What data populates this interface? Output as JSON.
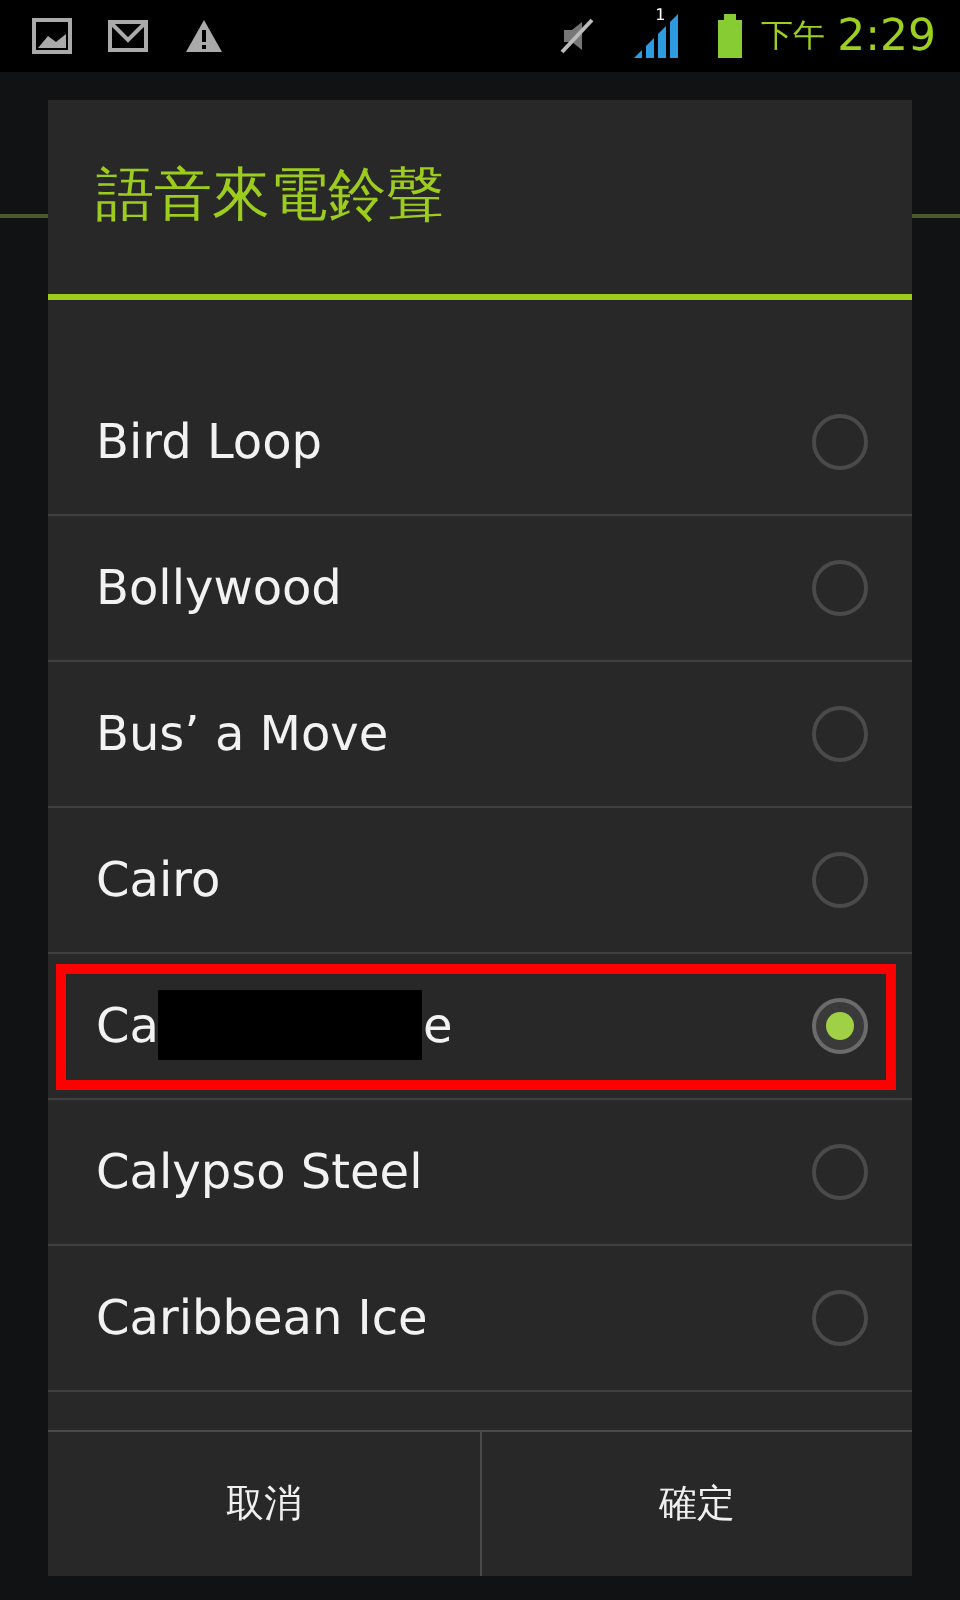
{
  "status_bar": {
    "period": "下午",
    "time": "2:29",
    "signal_label": "1"
  },
  "dialog": {
    "title": "語音來電鈴聲",
    "items": [
      {
        "kind": "plain",
        "label": "Bird Loop",
        "selected": false,
        "highlighted": false
      },
      {
        "kind": "plain",
        "label": "Bollywood",
        "selected": false,
        "highlighted": false
      },
      {
        "kind": "plain",
        "label": "Bus’ a Move",
        "selected": false,
        "highlighted": false
      },
      {
        "kind": "plain",
        "label": "Cairo",
        "selected": false,
        "highlighted": false
      },
      {
        "kind": "redacted",
        "label_start": "Ca",
        "label_end": "e",
        "selected": true,
        "highlighted": true
      },
      {
        "kind": "plain",
        "label": "Calypso Steel",
        "selected": false,
        "highlighted": false
      },
      {
        "kind": "plain",
        "label": "Caribbean Ice",
        "selected": false,
        "highlighted": false
      }
    ],
    "buttons": [
      "取消",
      "確定"
    ]
  }
}
